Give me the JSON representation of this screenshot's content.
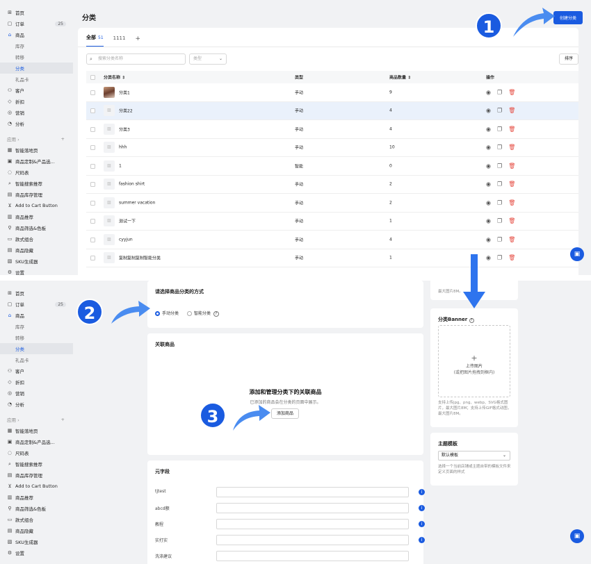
{
  "sidebar": {
    "items": [
      {
        "icon": "⊞",
        "label": "首页",
        "type": "main"
      },
      {
        "icon": "▢",
        "label": "订单",
        "type": "main",
        "badge": "25"
      },
      {
        "icon": "⌂",
        "label": "商品",
        "type": "main",
        "accent": true
      },
      {
        "label": "库存",
        "type": "sub"
      },
      {
        "label": "转移",
        "type": "sub"
      },
      {
        "label": "分类",
        "type": "sub",
        "active": true
      },
      {
        "label": "礼品卡",
        "type": "sub"
      },
      {
        "icon": "⚇",
        "label": "客户",
        "type": "main"
      },
      {
        "icon": "◇",
        "label": "折扣",
        "type": "main"
      },
      {
        "icon": "◎",
        "label": "营销",
        "type": "main"
      },
      {
        "icon": "◔",
        "label": "分析",
        "type": "main"
      },
      {
        "label": "应用 ›",
        "type": "group",
        "plus": "+"
      },
      {
        "icon": "▦",
        "label": "智能落地页",
        "type": "main"
      },
      {
        "icon": "▣",
        "label": "商品定制&产品选...",
        "type": "main"
      },
      {
        "icon": "◌",
        "label": "尺码表",
        "type": "main"
      },
      {
        "icon": "⌕",
        "label": "智能搜索推荐",
        "type": "main"
      },
      {
        "icon": "▤",
        "label": "商品库存管理",
        "type": "main"
      },
      {
        "icon": "⊻",
        "label": "Add to Cart Button",
        "type": "main"
      },
      {
        "icon": "▥",
        "label": "商品推荐",
        "type": "main"
      },
      {
        "icon": "⚲",
        "label": "商品筛选&色板",
        "type": "main"
      },
      {
        "icon": "▭",
        "label": "款式组合",
        "type": "main"
      },
      {
        "icon": "▤",
        "label": "商品隐藏",
        "type": "main"
      },
      {
        "icon": "▧",
        "label": "SKU生成器",
        "type": "main"
      },
      {
        "icon": "⚙",
        "label": "设置",
        "type": "main"
      }
    ]
  },
  "page_title": "分类",
  "create_button": "创建分类",
  "tabs": [
    {
      "label": "全部",
      "count": "51",
      "active": true
    },
    {
      "label": "1111"
    },
    {
      "label": "+"
    }
  ],
  "search_placeholder": "搜索分类名称",
  "type_select": "类型",
  "sort_button": "排序",
  "table": {
    "headers": [
      "分类名称 ⇕",
      "类型",
      "商品数量 ⇕",
      "操作"
    ],
    "rows": [
      {
        "name": "分类1",
        "type": "手动",
        "count": "9",
        "photo": true
      },
      {
        "name": "分类22",
        "type": "手动",
        "count": "4",
        "highlight": true
      },
      {
        "name": "分类3",
        "type": "手动",
        "count": "4"
      },
      {
        "name": "hhh",
        "type": "手动",
        "count": "10"
      },
      {
        "name": "1",
        "type": "智能",
        "count": "0"
      },
      {
        "name": "fashion shirt",
        "type": "手动",
        "count": "2"
      },
      {
        "name": "summer vacation",
        "type": "手动",
        "count": "2"
      },
      {
        "name": "测试一下",
        "type": "手动",
        "count": "1"
      },
      {
        "name": "cyyjun",
        "type": "手动",
        "count": "4"
      },
      {
        "name": "复制复制复制智能分类",
        "type": "手动",
        "count": "1"
      }
    ]
  },
  "steps": [
    "1",
    "2",
    "3"
  ],
  "bottom": {
    "method_title": "请选择商品分类的方式",
    "manual_option": "手动分类",
    "smart_option": "智能分类",
    "related_title": "关联商品",
    "related_heading": "添加和管理分类下的关联商品",
    "related_desc": "已添加的商品会在分类的页面中展示。",
    "add_product_button": "添加商品",
    "meta_title": "元字段",
    "meta_fields": [
      "tjtest",
      "abcd额",
      "教程",
      "实打实",
      "洗涤建议"
    ],
    "top_right_note_1": "最大图片8M。",
    "banner_title": "分类Banner",
    "upload_label": "上传图片",
    "upload_hint": "(或把图片拖拽到框内)",
    "banner_note": "支持上传jpg、png、webp、SVG格式图片，最大图片8M；支持上传GIF格式动图，最大图片8M。",
    "template_title": "主题模板",
    "template_value": "默认模板",
    "template_note": "选择一个当前店铺或主题自带的模板文件来定义页面的样式"
  },
  "colors": {
    "accent": "#1a5be0",
    "delete": "#e5483e",
    "highlight_row": "#eaf1fb"
  }
}
